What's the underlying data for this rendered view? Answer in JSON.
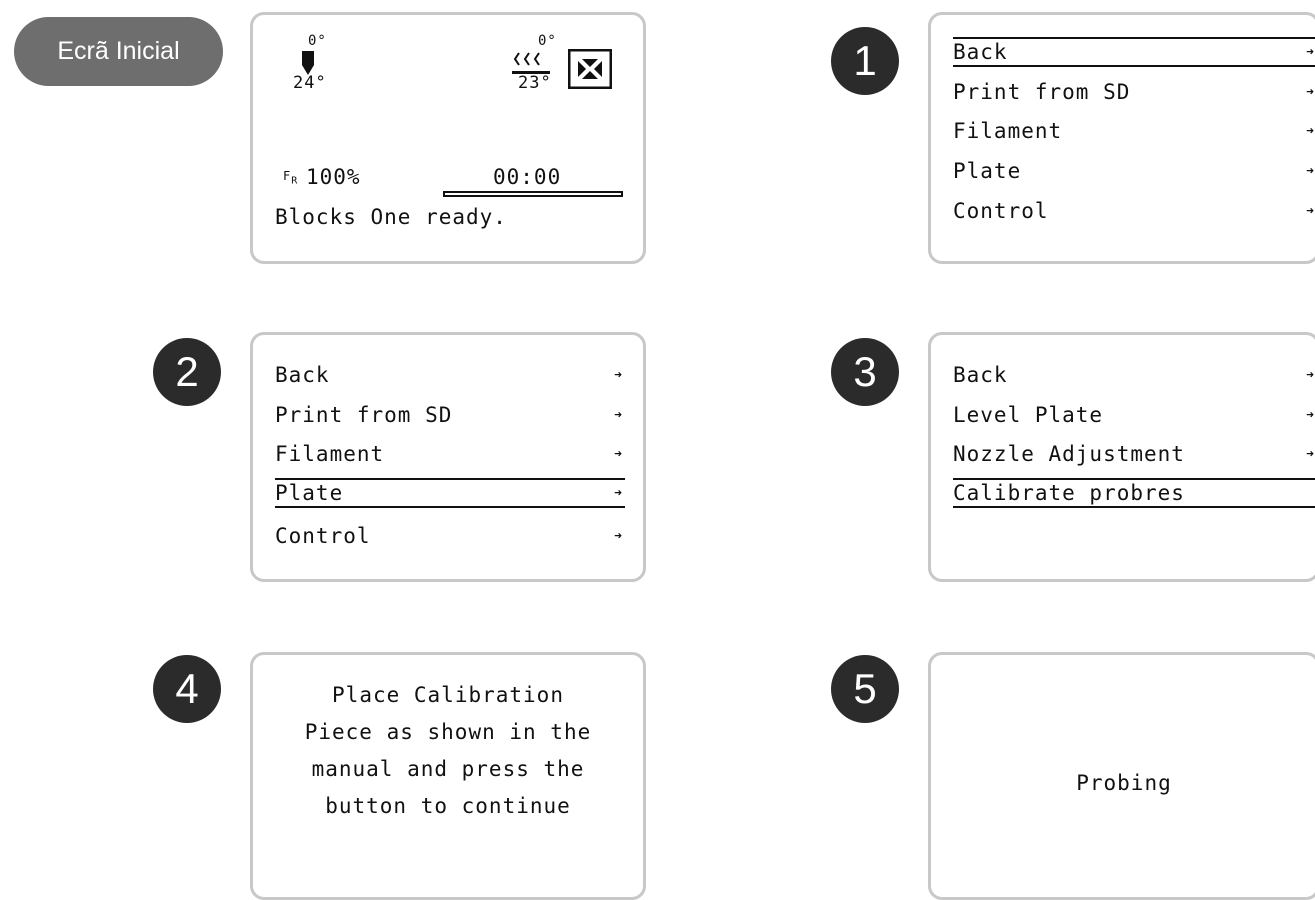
{
  "home_label": "Ecrã Inicial",
  "steps": [
    "1",
    "2",
    "3",
    "4",
    "5"
  ],
  "home_screen": {
    "nozzle_target": "0°",
    "nozzle_current": "24°",
    "bed_target": "0°",
    "bed_current": "23°",
    "feed_rate": "100%",
    "time": "00:00",
    "status": "Blocks One ready."
  },
  "menu1": {
    "items": [
      {
        "label": "Back",
        "arrow": "➜"
      },
      {
        "label": "Print from SD",
        "arrow": "➜"
      },
      {
        "label": "Filament",
        "arrow": "➜"
      },
      {
        "label": "Plate",
        "arrow": "➜"
      },
      {
        "label": "Control",
        "arrow": "➜"
      }
    ]
  },
  "menu2": {
    "items": [
      {
        "label": "Back",
        "arrow": "➜"
      },
      {
        "label": "Print from SD",
        "arrow": "➜"
      },
      {
        "label": "Filament",
        "arrow": "➜"
      },
      {
        "label": "Plate",
        "arrow": "➜"
      },
      {
        "label": "Control",
        "arrow": "➜"
      }
    ]
  },
  "menu3": {
    "items": [
      {
        "label": "Back",
        "arrow": "➜"
      },
      {
        "label": "Level Plate",
        "arrow": "➜"
      },
      {
        "label": "Nozzle Adjustment",
        "arrow": "➜"
      },
      {
        "label": "Calibrate probres",
        "arrow": ""
      }
    ]
  },
  "screen4": {
    "lines": [
      "Place Calibration",
      "Piece as shown in the",
      "manual and press the",
      "button to continue"
    ]
  },
  "screen5": {
    "text": "Probing"
  }
}
